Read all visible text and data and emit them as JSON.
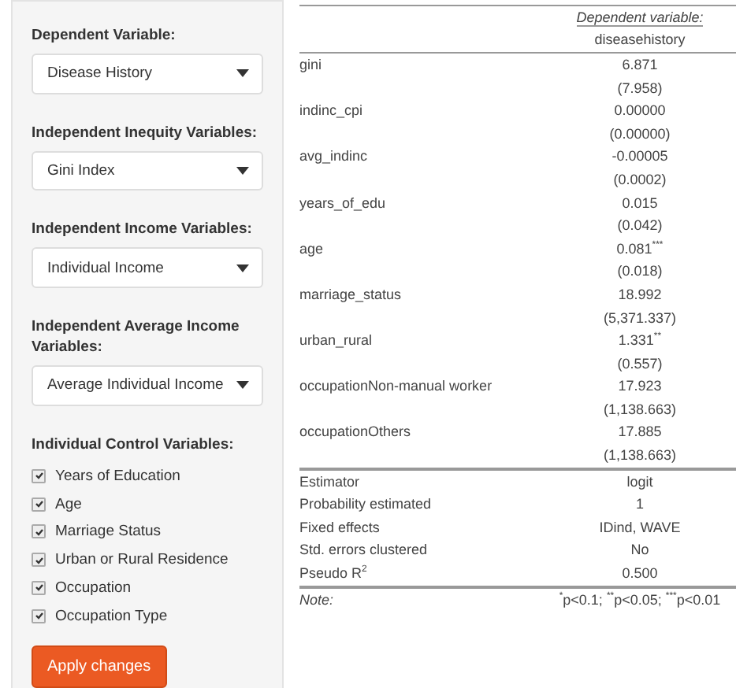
{
  "sidebar": {
    "selects": [
      {
        "label": "Dependent Variable:",
        "value": "Disease History"
      },
      {
        "label": "Independent Inequity Variables:",
        "value": "Gini Index"
      },
      {
        "label": "Independent Income Variables:",
        "value": "Individual Income"
      },
      {
        "label": "Independent Average Income Variables:",
        "value": "Average Individual Income"
      }
    ],
    "controls_label": "Individual Control Variables:",
    "controls": [
      {
        "label": "Years of Education",
        "checked": true
      },
      {
        "label": "Age",
        "checked": true
      },
      {
        "label": "Marriage Status",
        "checked": true
      },
      {
        "label": "Urban or Rural Residence",
        "checked": true
      },
      {
        "label": "Occupation",
        "checked": true
      },
      {
        "label": "Occupation Type",
        "checked": true
      }
    ],
    "apply_button": "Apply changes"
  },
  "table": {
    "header": "Dependent variable:",
    "dependent": "diseasehistory",
    "coefficients": [
      {
        "name": "gini",
        "estimate": "6.871",
        "se": "(7.958)"
      },
      {
        "name": "indinc_cpi",
        "estimate": "0.00000",
        "se": "(0.00000)"
      },
      {
        "name": "avg_indinc",
        "estimate": "-0.00005",
        "se": "(0.0002)"
      },
      {
        "name": "years_of_edu",
        "estimate": "0.015",
        "se": "(0.042)"
      },
      {
        "name": "age",
        "estimate": "0.081$^{***}$",
        "se": "(0.018)"
      },
      {
        "name": "marriage_status",
        "estimate": "18.992",
        "se": "(5,371.337)"
      },
      {
        "name": "urban_rural",
        "estimate": "1.331$^{**}$",
        "se": "(0.557)"
      },
      {
        "name": "occupationNon-manual worker",
        "estimate": "17.923",
        "se": "(1,138.663)"
      },
      {
        "name": "occupationOthers",
        "estimate": "17.885",
        "se": "(1,138.663)"
      }
    ],
    "stats": [
      {
        "name": "Estimator",
        "value": "logit"
      },
      {
        "name": "Probability estimated",
        "value": "1"
      },
      {
        "name": "Fixed effects",
        "value": "IDind, WAVE"
      },
      {
        "name": "Std. errors clustered",
        "value": "No"
      },
      {
        "name": "Pseudo R$^{2}$",
        "value": "0.500"
      }
    ],
    "note_label": "Note:",
    "note": "$^{*}$p<0.1; $^{**}$p<0.05; $^{***}$p<0.01"
  }
}
